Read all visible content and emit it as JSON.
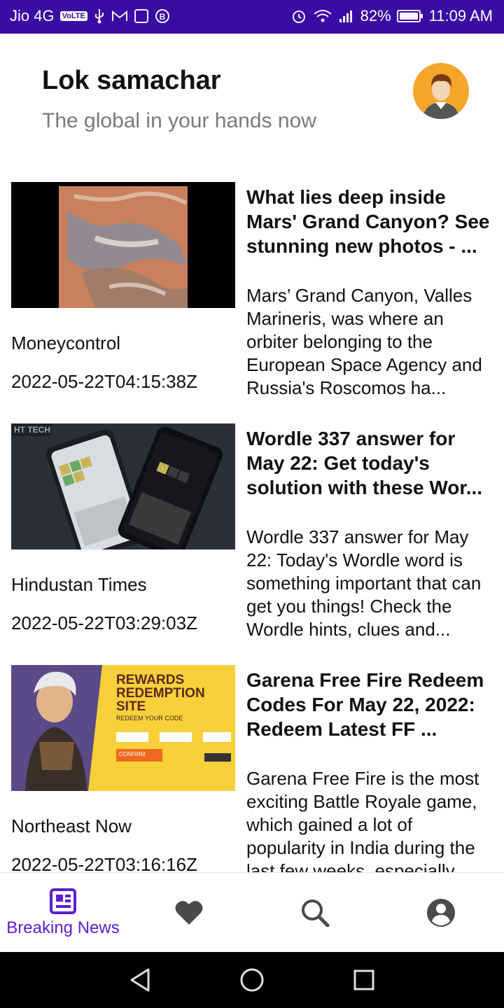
{
  "status_bar": {
    "carrier": "Jio 4G",
    "volte": "VoLTE",
    "battery": "82%",
    "time": "11:09 AM"
  },
  "header": {
    "title": "Lok samachar",
    "subtitle": "The global in your hands now"
  },
  "articles": [
    {
      "headline": "What lies deep inside Mars' Grand Canyon? See stunning new photos - ...",
      "description": "Mars’ Grand Canyon, Valles Marineris, was where an orbiter belonging to the European Space Agency and Russia's Roscomos ha...",
      "source": "Moneycontrol",
      "date": "2022-05-22T04:15:38Z"
    },
    {
      "headline": "Wordle 337 answer for May 22: Get today's solution with these Wor...",
      "description": "Wordle 337 answer for May 22: Today's Wordle word is something important that can get you things! Check the Wordle hints, clues and...",
      "source": "Hindustan Times",
      "date": "2022-05-22T03:29:03Z",
      "thumb_label": "HT TECH"
    },
    {
      "headline": "Garena Free Fire Redeem Codes For May 22, 2022: Redeem Latest FF ...",
      "description": "Garena Free Fire is the most exciting Battle Royale game, which gained a lot of popularity in India during the last few weeks, especially",
      "source": "Northeast Now",
      "date": "2022-05-22T03:16:16Z",
      "thumb_lines": [
        "REWARDS",
        "REDEMPTION",
        "SITE"
      ],
      "thumb_sub": "REDEEM YOUR CODE",
      "thumb_button": "CONFIRM"
    }
  ],
  "bottom_nav": {
    "active_label": "Breaking News"
  },
  "colors": {
    "status_bar": "#3a0ca3",
    "accent": "#5b1fd1",
    "icon_gray": "#4a4a4a"
  }
}
